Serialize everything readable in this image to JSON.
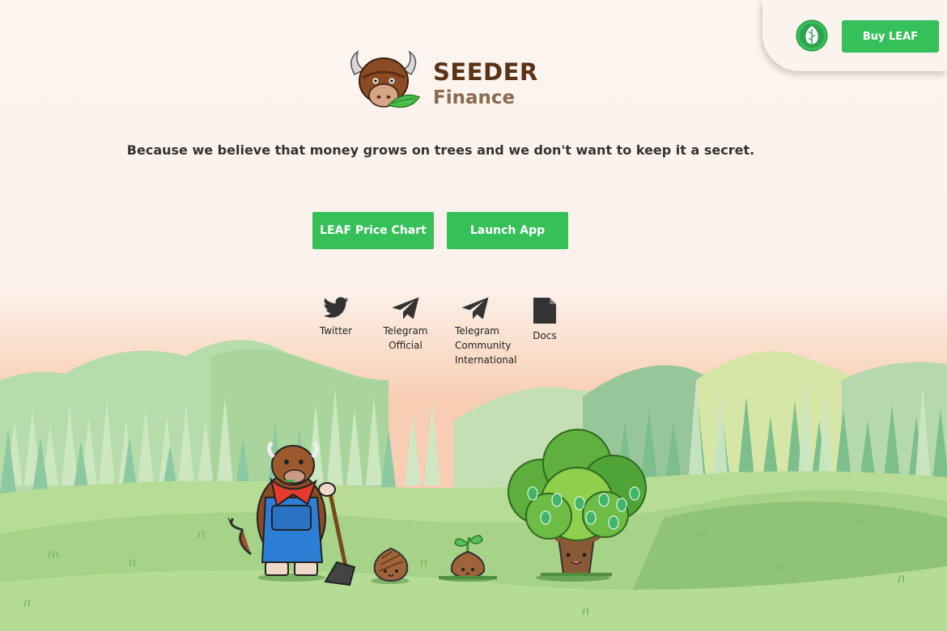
{
  "header": {
    "buy_label": "Buy LEAF"
  },
  "logo": {
    "title": "SEEDER",
    "subtitle": "Finance"
  },
  "tagline": "Because we believe that money grows on trees and we don't want to keep it a secret.",
  "cta": {
    "price_chart_label": "LEAF Price Chart",
    "launch_label": "Launch App"
  },
  "social": [
    {
      "label": "Twitter",
      "icon": "twitter-icon"
    },
    {
      "label": "Telegram Official",
      "icon": "telegram-icon"
    },
    {
      "label": "Telegram Community International",
      "icon": "telegram-icon"
    },
    {
      "label": "Docs",
      "icon": "document-icon"
    }
  ],
  "colors": {
    "accent": "#35c05a",
    "brand_brown": "#5a3318",
    "brand_tan": "#8b6a4f"
  }
}
